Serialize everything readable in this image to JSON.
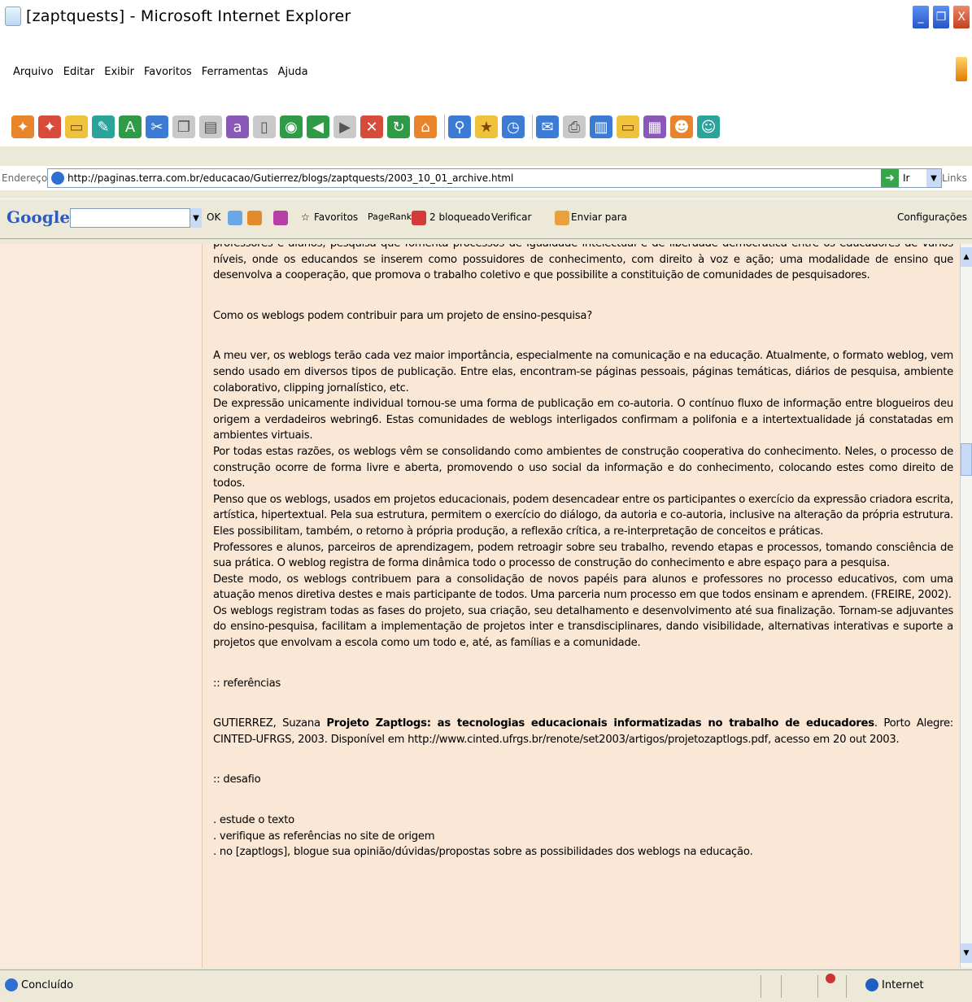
{
  "window": {
    "title": "[zaptquests] - Microsoft Internet Explorer",
    "controls": [
      "_",
      "❐",
      "X"
    ]
  },
  "menu": [
    "Arquivo",
    "Editar",
    "Exibir",
    "Favoritos",
    "Ferramentas",
    "Ajuda"
  ],
  "address_bar": {
    "label": "Endereço",
    "url": "http://paginas.terra.com.br/educacao/Gutierrez/blogs/zaptquests/2003_10_01_archive.html",
    "go_label": "Ir",
    "links_label": "Links"
  },
  "google_bar": {
    "logo": "Google",
    "g_icon": "G",
    "ok": "OK",
    "favoritos": "Favoritos",
    "pagerank": "PageRank",
    "bloqueado": "2 bloqueado",
    "verificar": "Verificar",
    "enviar": "Enviar para",
    "configuracoes": "Configurações"
  },
  "article": {
    "p0": "professores e alunos, pesquisa que fomenta processos de igualdade intelectual e de liberdade democrática entre os educadores de vários níveis, onde os educandos se inserem como possuidores de conhecimento, com direito à voz e ação; uma modalidade de ensino que desenvolva a cooperação, que promova o trabalho coletivo e que possibilite a constituição de comunidades de pesquisadores.",
    "q": "Como os weblogs podem contribuir para um projeto de ensino-pesquisa?",
    "p1": "A meu ver, os weblogs terão cada vez maior importância, especialmente na comunicação e na educação. Atualmente, o formato weblog, vem sendo usado em diversos tipos de publicação. Entre elas, encontram-se páginas pessoais, páginas temáticas, diários de pesquisa, ambiente colaborativo, clipping jornalístico, etc.",
    "p2": "De expressão unicamente individual tornou-se uma forma de publicação em co-autoria. O contínuo fluxo de informação entre blogueiros deu origem a verdadeiros webring6. Estas comunidades de weblogs interligados confirmam a polifonia e a intertextualidade já constatadas em ambientes virtuais.",
    "p3": "Por todas estas razões, os weblogs vêm se consolidando como ambientes de construção cooperativa do conhecimento. Neles, o processo de construção ocorre de forma livre e aberta, promovendo o uso social da informação e do conhecimento, colocando estes como direito de todos.",
    "p4": "Penso que os weblogs, usados em projetos educacionais, podem desencadear entre os participantes o exercício da expressão criadora escrita, artística, hipertextual. Pela sua estrutura, permitem o exercício do diálogo, da autoria e co-autoria, inclusive na alteração da própria estrutura. Eles possibilitam, também, o retorno à própria produção, a reflexão crítica, a re-interpretação de conceitos e práticas.",
    "p5": "Professores e alunos, parceiros de aprendizagem, podem retroagir sobre seu trabalho, revendo etapas e processos, tomando consciência de sua prática. O weblog registra de forma dinâmica todo o processo de construção do conhecimento e abre espaço para a pesquisa.",
    "p6": "Deste modo, os weblogs contribuem para a consolidação de novos papéis para alunos e professores no processo educativos, com uma atuação menos diretiva destes e mais participante de todos. Uma parceria num processo em que todos ensinam e aprendem. (FREIRE, 2002).",
    "p7": "Os weblogs registram todas as fases do projeto, sua criação, seu detalhamento e desenvolvimento até sua finalização. Tornam-se adjuvantes do ensino-pesquisa, facilitam a implementação de projetos inter e transdisciplinares, dando visibilidade, alternativas interativas e suporte a projetos que envolvam a escola como um todo e, até, as famílias e a comunidade.",
    "ref_heading": ":: referências",
    "ref_author": "GUTIERREZ, Suzana ",
    "ref_title": "Projeto Zaptlogs: as tecnologias educacionais informatizadas no trabalho de educadores",
    "ref_rest": ". Porto Alegre: CINTED-UFRGS, 2003. Disponível em http://www.cinted.ufrgs.br/renote/set2003/artigos/projetozaptlogs.pdf, acesso em 20 out 2003.",
    "challenge_heading": ":: desafio",
    "tasks": [
      ". estude o texto",
      ". verifique as referências no site de origem",
      ". no [zaptlogs], blogue sua opinião/dúvidas/propostas sobre as possibilidades dos weblogs na educação."
    ]
  },
  "status_bar": {
    "text": "Concluído",
    "zone": "Internet"
  }
}
